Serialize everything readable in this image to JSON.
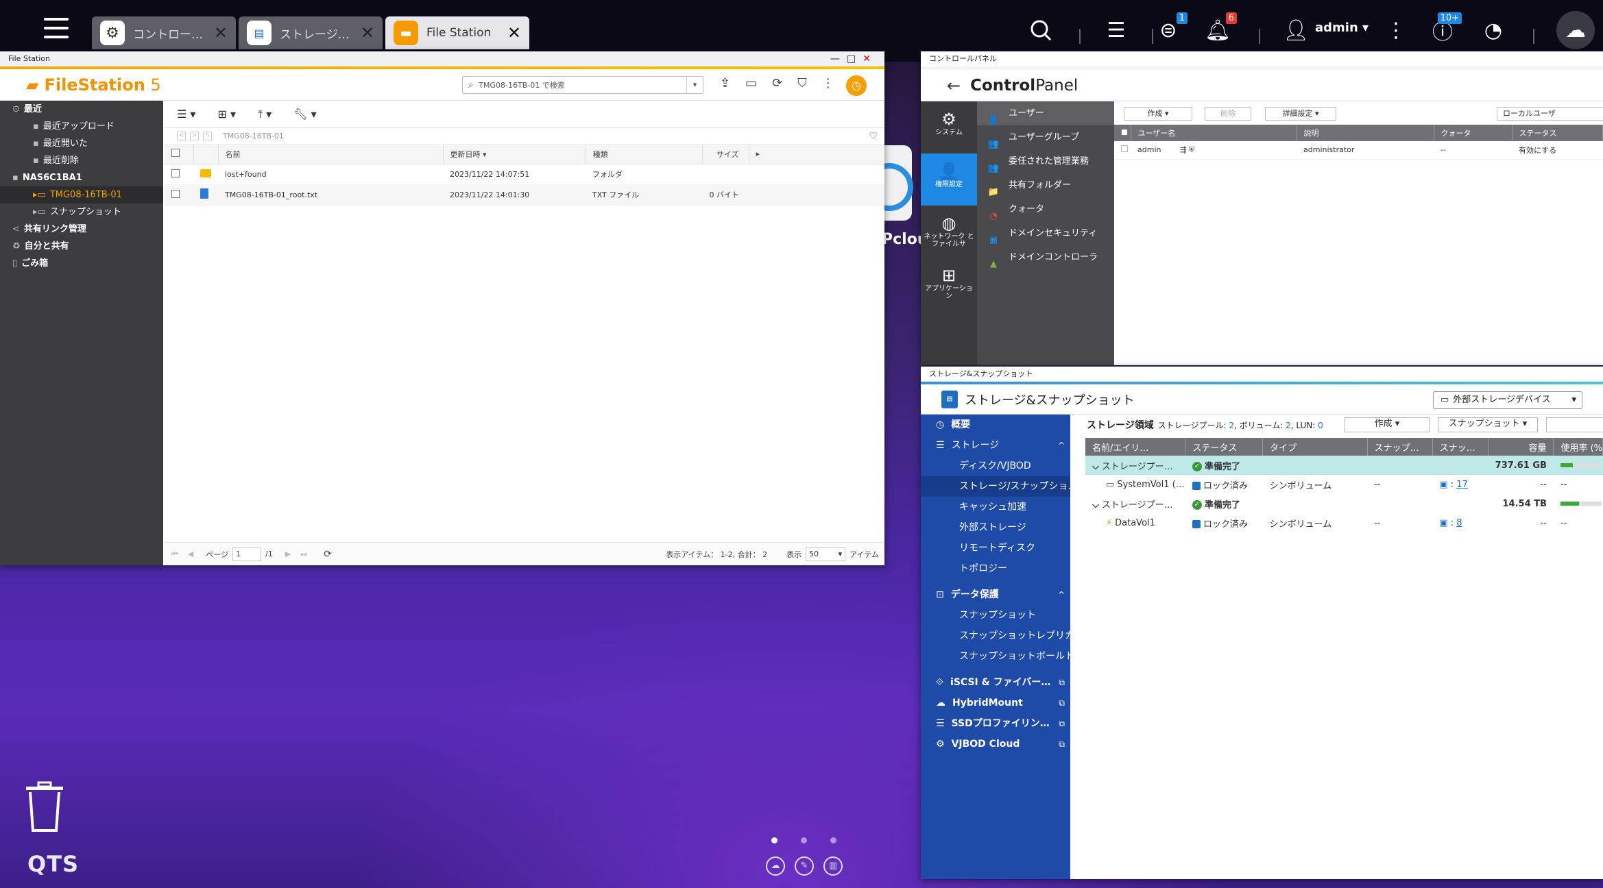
{
  "taskbar": {
    "tabs": [
      {
        "label": "コントロー…",
        "icon": "gear-icon"
      },
      {
        "label": "ストレージ…",
        "icon": "storage-icon"
      },
      {
        "label": "File Station",
        "icon": "folder-icon"
      }
    ],
    "user": "admin ▾",
    "badges": {
      "tasks": "1",
      "notifications": "6",
      "updates": "10+"
    }
  },
  "filestation": {
    "window_title": "File Station",
    "app_title_bold": "FileStation",
    "app_title_ver": " 5",
    "search_placeholder": "TMG08-16TB-01 で検索",
    "path": "TMG08-16TB-01",
    "sidebar": [
      {
        "label": "最近",
        "level": 0,
        "icon": "⊙",
        "bold": true
      },
      {
        "label": "最近アップロード",
        "level": 1,
        "icon": "▪"
      },
      {
        "label": "最近開いた",
        "level": 1,
        "icon": "▪"
      },
      {
        "label": "最近削除",
        "level": 1,
        "icon": "▪"
      },
      {
        "label": "NAS6C1BA1",
        "level": 0,
        "icon": "▪",
        "bold": true
      },
      {
        "label": "TMG08-16TB-01",
        "level": 1,
        "icon": "▸▭",
        "selected": true
      },
      {
        "label": "スナップショット",
        "level": 1,
        "icon": "▸▭"
      },
      {
        "label": "共有リンク管理",
        "level": 0,
        "icon": "<",
        "bold": true
      },
      {
        "label": "自分と共有",
        "level": 0,
        "icon": "♻",
        "bold": true
      },
      {
        "label": "ごみ箱",
        "level": 0,
        "icon": "▯",
        "bold": true
      }
    ],
    "columns": {
      "name": "名前",
      "modified": "更新日時 ▾",
      "type": "種類",
      "size": "サイズ"
    },
    "files": [
      {
        "name": "lost+found",
        "modified": "2023/11/22 14:07:51",
        "type": "フォルダ",
        "size": "",
        "kind": "folder"
      },
      {
        "name": "TMG08-16TB-01_root.txt",
        "modified": "2023/11/22 14:01:30",
        "type": "TXT ファイル",
        "size": "0 バイト",
        "kind": "txt"
      }
    ],
    "status": {
      "page_label": "ページ",
      "page": "1",
      "page_total": "/1",
      "items": "表示アイテム： 1-2, 合計： 2",
      "show": "表示",
      "per_page": "50",
      "unit": "アイテム"
    }
  },
  "controlpanel": {
    "window_title": "コントロールパネル",
    "title_bold": "Control",
    "title_rest": "Panel",
    "categories": [
      {
        "label": "システム",
        "icon": "⚙"
      },
      {
        "label": "権限設定",
        "icon": "👤",
        "selected": true
      },
      {
        "label": "ネットワーク とファイルサ",
        "icon": "◍"
      },
      {
        "label": "アプリケーション",
        "icon": "⊞"
      }
    ],
    "menu": [
      {
        "label": "ユーザー",
        "icon": "👤",
        "color": "#7fb3ff",
        "selected": true
      },
      {
        "label": "ユーザーグループ",
        "icon": "👥",
        "color": "#f5c542"
      },
      {
        "label": "委任された管理業務",
        "icon": "👥",
        "color": "#f57c42"
      },
      {
        "label": "共有フォルダー",
        "icon": "📁",
        "color": "#f5b400"
      },
      {
        "label": "クォータ",
        "icon": "◔",
        "color": "#e74c3c"
      },
      {
        "label": "ドメインセキュリティ",
        "icon": "▣",
        "color": "#1e88e5"
      },
      {
        "label": "ドメインコントローラ",
        "icon": "▲",
        "color": "#7cb342"
      }
    ],
    "buttons": {
      "create": "作成",
      "delete": "削除",
      "advanced": "詳細設定",
      "filter": "ローカルユーザ"
    },
    "columns": {
      "user": "ユーザー名",
      "desc": "説明",
      "quota": "クォータ",
      "status": "ステータス"
    },
    "users": [
      {
        "name": "admin",
        "desc": "administrator",
        "quota": "--",
        "status": "有効にする"
      }
    ]
  },
  "storage": {
    "window_title": "ストレージ&スナップショット",
    "title": "ストレージ&スナップショット",
    "external": "外部ストレージデバイス",
    "header_label": "ストレージ領域",
    "header_stats_pre": "ストレージプール: ",
    "pool_count": "2",
    "header_stats_mid": ", ボリューム: ",
    "vol_count": "2",
    "header_stats_lun": ", LUN: ",
    "lun_count": "0",
    "btn_create": "作成",
    "btn_snapshot": "スナップショット",
    "nav": [
      {
        "label": "概要",
        "icon": "◷",
        "level": 0,
        "bold": true
      },
      {
        "label": "ストレージ",
        "icon": "☰",
        "level": 0,
        "expand": "^"
      },
      {
        "label": "ディスク/VJBOD",
        "level": 1
      },
      {
        "label": "ストレージ/スナップショ…",
        "level": 1,
        "selected": true
      },
      {
        "label": "キャッシュ加速",
        "level": 1
      },
      {
        "label": "外部ストレージ",
        "level": 1
      },
      {
        "label": "リモートディスク",
        "level": 1
      },
      {
        "label": "トポロジー",
        "level": 1
      },
      {
        "label": "データ保護",
        "icon": "⊡",
        "level": 0,
        "bold": true,
        "expand": "^"
      },
      {
        "label": "スナップショット",
        "level": 1
      },
      {
        "label": "スナップショットレプリカ",
        "level": 1
      },
      {
        "label": "スナップショットボールト",
        "level": 1
      },
      {
        "label": "iSCSI & ファイバー…",
        "icon": "⟐",
        "level": 0,
        "bold": true,
        "ext": true
      },
      {
        "label": "HybridMount",
        "icon": "☁",
        "level": 0,
        "bold": true,
        "ext": true
      },
      {
        "label": "SSDプロファイリン…",
        "icon": "☰",
        "level": 0,
        "bold": true,
        "ext": true
      },
      {
        "label": "VJBOD Cloud",
        "icon": "⚙",
        "level": 0,
        "bold": true,
        "ext": true
      }
    ],
    "columns": {
      "name": "名前/エイリ…",
      "status": "ステータス",
      "type": "タイプ",
      "snap1": "スナップ…",
      "snap2": "スナッ…",
      "cap": "容量",
      "usage": "使用率 (%"
    },
    "rows": [
      {
        "kind": "pool",
        "name": "ストレージプー…",
        "status": "準備完了",
        "type": "",
        "snap1": "",
        "snap2": "",
        "cap": "737.61 GB",
        "usage_pct": 30
      },
      {
        "kind": "vol",
        "name": "SystemVol1 (…",
        "status": "ロック済み",
        "type": "シンボリューム",
        "snap1": "--",
        "snap2": "17",
        "cap": "--",
        "usage": "--"
      },
      {
        "kind": "pool2",
        "name": "ストレージプー…",
        "status": "準備完了",
        "type": "",
        "snap1": "",
        "snap2": "",
        "cap": "14.54 TB",
        "usage_pct": 45
      },
      {
        "kind": "vol",
        "name": "DataVol1",
        "status": "ロック済み",
        "type": "シンボリューム",
        "snap1": "--",
        "snap2": "8",
        "cap": "--",
        "usage": "--"
      }
    ]
  },
  "desktop": {
    "brand": "QTS",
    "pcloud": "Pclou"
  }
}
